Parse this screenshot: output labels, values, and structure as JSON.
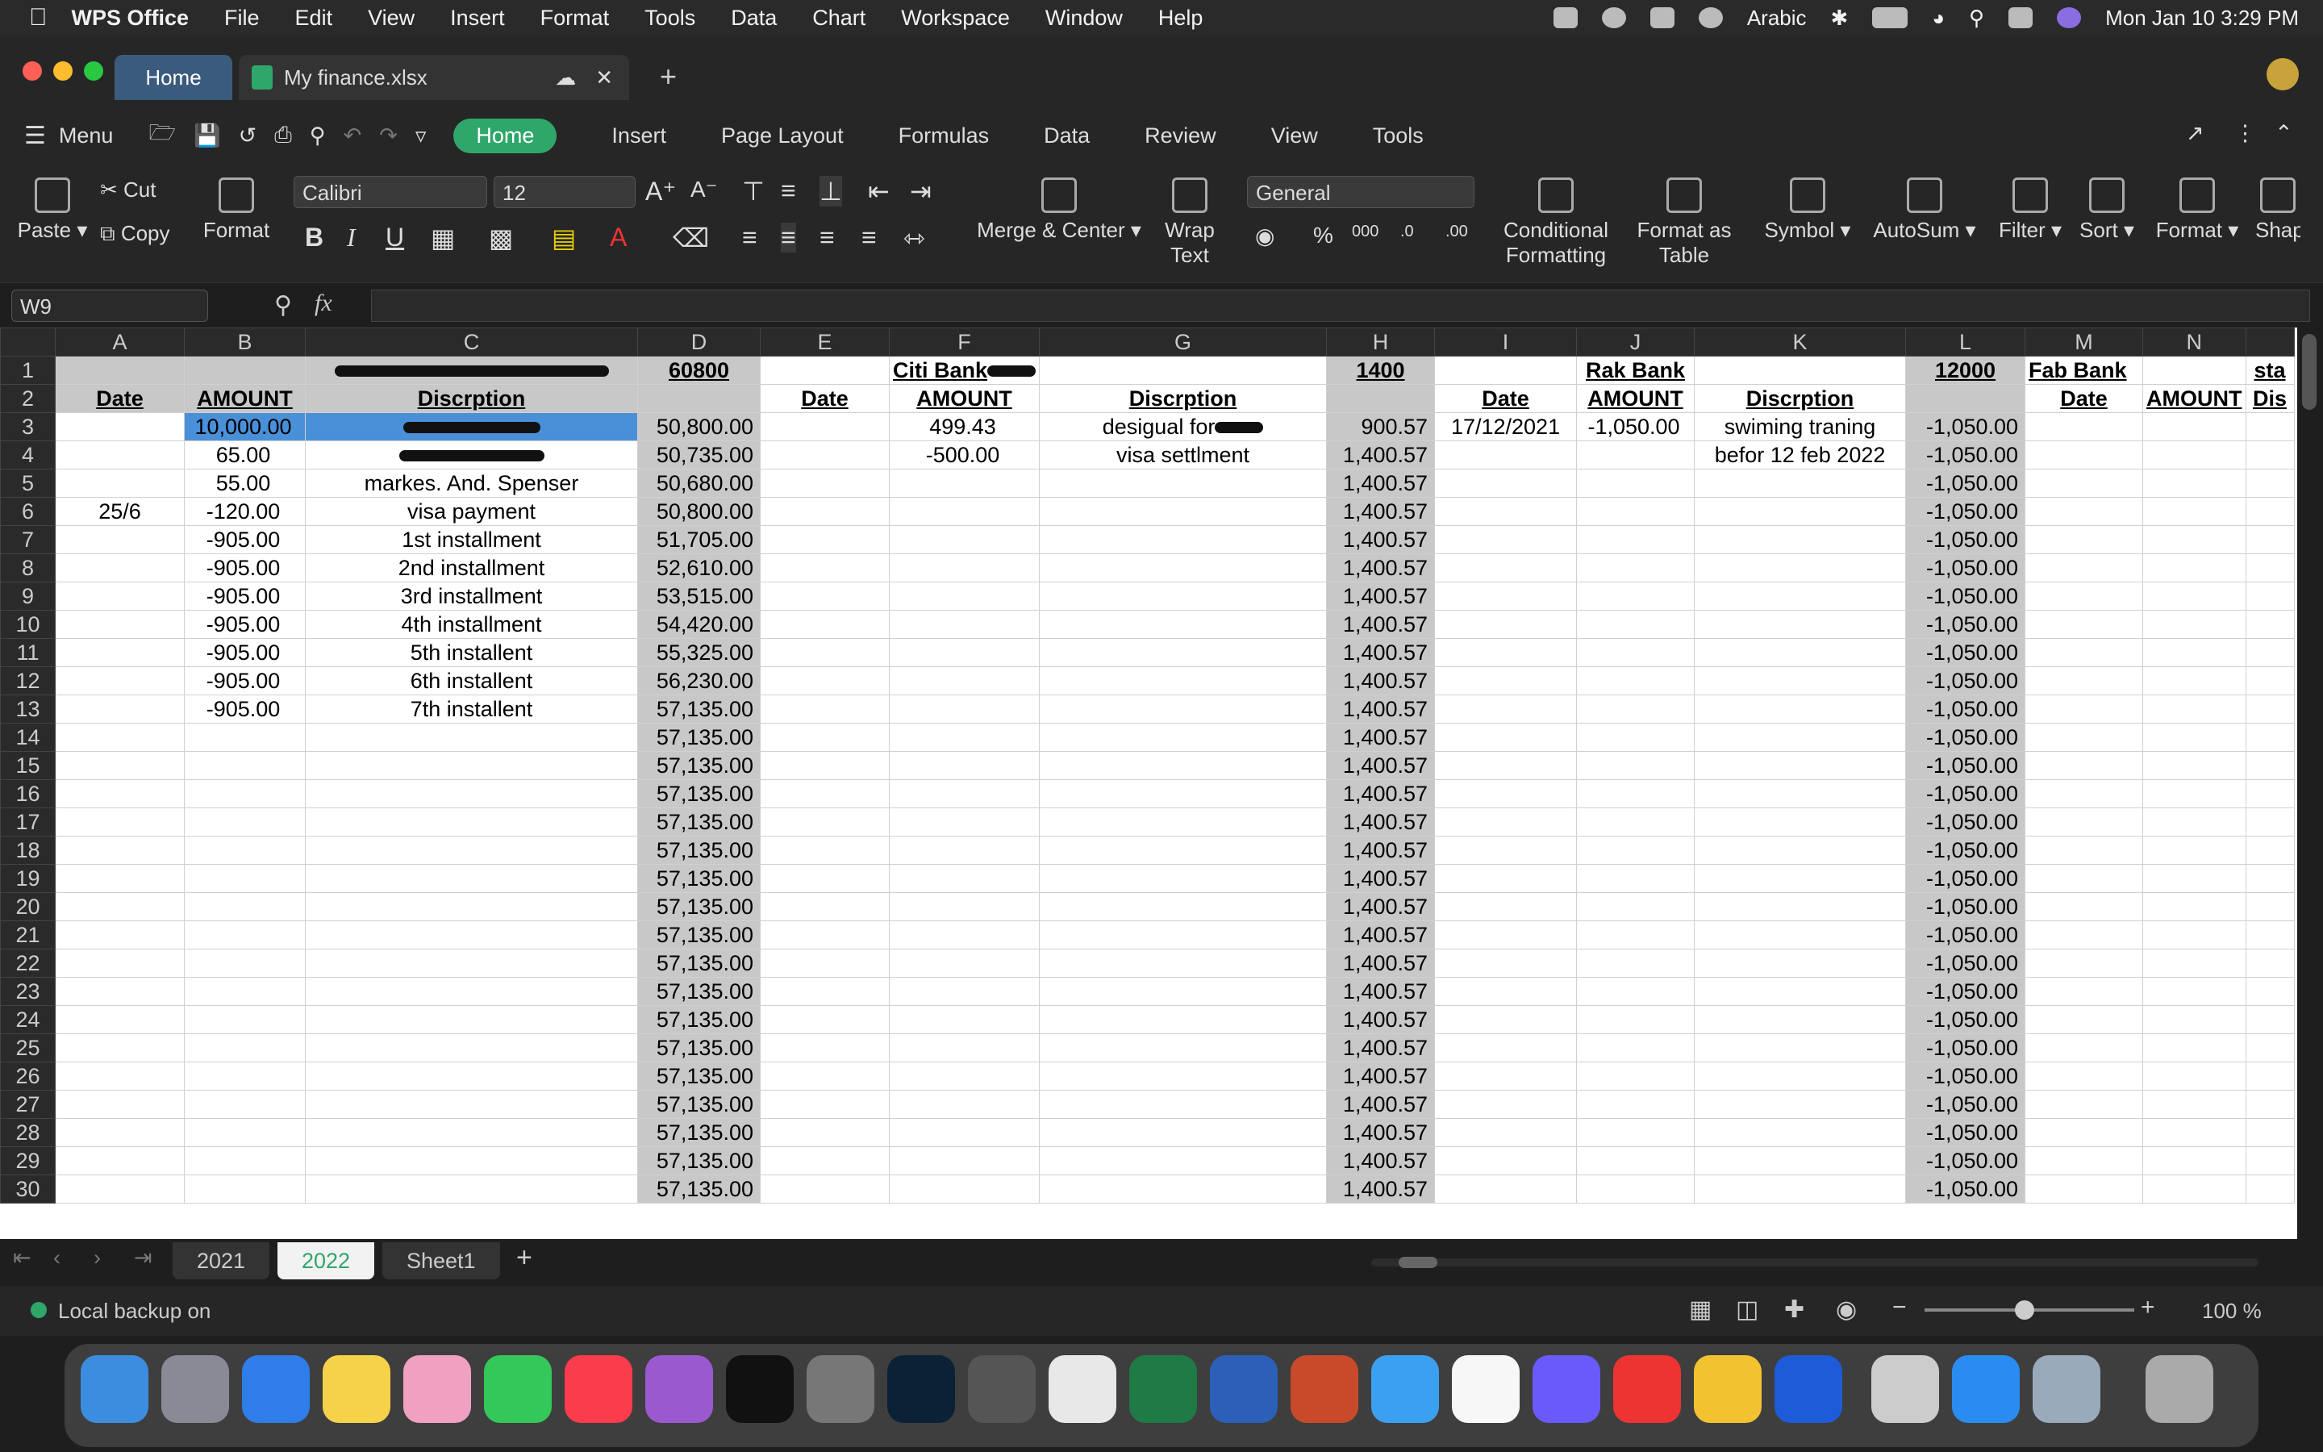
{
  "menubar": {
    "app": "WPS Office",
    "items": [
      "File",
      "Edit",
      "View",
      "Insert",
      "Format",
      "Tools",
      "Data",
      "Chart",
      "Workspace",
      "Window",
      "Help"
    ],
    "input_source": "Arabic",
    "clock": "Mon Jan 10  3:29 PM"
  },
  "window": {
    "home_tab": "Home",
    "file_tab": "My finance.xlsx"
  },
  "ribbon_tabs": [
    "Menu",
    "Home",
    "Insert",
    "Page Layout",
    "Formulas",
    "Data",
    "Review",
    "View",
    "Tools"
  ],
  "ribbon": {
    "paste": "Paste",
    "cut": "Cut",
    "copy": "Copy",
    "format_painter": "Format",
    "font": "Calibri",
    "size": "12",
    "merge": "Merge & Center",
    "wrap1": "Wrap",
    "wrap2": "Text",
    "numfmt": "General",
    "cond1": "Conditional",
    "cond2": "Formatting",
    "fmt_table1": "Format as",
    "fmt_table2": "Table",
    "symbol": "Symbol",
    "autosum": "AutoSum",
    "filter": "Filter",
    "sort": "Sort",
    "format": "Format",
    "shape": "Shap"
  },
  "formula_bar": {
    "name_box": "W9",
    "fx": "fx",
    "value": ""
  },
  "columns": [
    "A",
    "B",
    "C",
    "D",
    "E",
    "F",
    "G",
    "H",
    "I",
    "J",
    "K",
    "L",
    "M",
    "N",
    ""
  ],
  "rows": [
    [
      "",
      "",
      "",
      "60800",
      "",
      "Citi Bank",
      "",
      "1400",
      "",
      "Rak Bank",
      "",
      "12000",
      "Fab Bank",
      "",
      "sta"
    ],
    [
      "Date",
      "AMOUNT",
      "Discrption",
      "",
      "Date",
      "AMOUNT",
      "Discrption",
      "",
      "Date",
      "AMOUNT",
      "Discrption",
      "",
      "Date",
      "AMOUNT",
      "Dis"
    ],
    [
      "",
      "10,000.00",
      "",
      "50,800.00",
      "",
      "499.43",
      "desigual for",
      "900.57",
      "17/12/2021",
      "-1,050.00",
      "swiming traning",
      "-1,050.00",
      "",
      "",
      ""
    ],
    [
      "",
      "65.00",
      "",
      "50,735.00",
      "",
      "-500.00",
      "visa settlment",
      "1,400.57",
      "",
      "",
      "befor 12 feb 2022",
      "-1,050.00",
      "",
      "",
      ""
    ],
    [
      "",
      "55.00",
      "markes. And. Spenser",
      "50,680.00",
      "",
      "",
      "",
      "1,400.57",
      "",
      "",
      "",
      "-1,050.00",
      "",
      "",
      ""
    ],
    [
      "25/6",
      "-120.00",
      "visa  payment",
      "50,800.00",
      "",
      "",
      "",
      "1,400.57",
      "",
      "",
      "",
      "-1,050.00",
      "",
      "",
      ""
    ],
    [
      "",
      "-905.00",
      "1st installment",
      "51,705.00",
      "",
      "",
      "",
      "1,400.57",
      "",
      "",
      "",
      "-1,050.00",
      "",
      "",
      ""
    ],
    [
      "",
      "-905.00",
      "2nd installment",
      "52,610.00",
      "",
      "",
      "",
      "1,400.57",
      "",
      "",
      "",
      "-1,050.00",
      "",
      "",
      ""
    ],
    [
      "",
      "-905.00",
      "3rd installment",
      "53,515.00",
      "",
      "",
      "",
      "1,400.57",
      "",
      "",
      "",
      "-1,050.00",
      "",
      "",
      ""
    ],
    [
      "",
      "-905.00",
      "4th installment",
      "54,420.00",
      "",
      "",
      "",
      "1,400.57",
      "",
      "",
      "",
      "-1,050.00",
      "",
      "",
      ""
    ],
    [
      "",
      "-905.00",
      "5th installent",
      "55,325.00",
      "",
      "",
      "",
      "1,400.57",
      "",
      "",
      "",
      "-1,050.00",
      "",
      "",
      ""
    ],
    [
      "",
      "-905.00",
      "6th installent",
      "56,230.00",
      "",
      "",
      "",
      "1,400.57",
      "",
      "",
      "",
      "-1,050.00",
      "",
      "",
      ""
    ],
    [
      "",
      "-905.00",
      "7th installent",
      "57,135.00",
      "",
      "",
      "",
      "1,400.57",
      "",
      "",
      "",
      "-1,050.00",
      "",
      "",
      ""
    ],
    [
      "",
      "",
      "",
      "57,135.00",
      "",
      "",
      "",
      "1,400.57",
      "",
      "",
      "",
      "-1,050.00",
      "",
      "",
      ""
    ],
    [
      "",
      "",
      "",
      "57,135.00",
      "",
      "",
      "",
      "1,400.57",
      "",
      "",
      "",
      "-1,050.00",
      "",
      "",
      ""
    ],
    [
      "",
      "",
      "",
      "57,135.00",
      "",
      "",
      "",
      "1,400.57",
      "",
      "",
      "",
      "-1,050.00",
      "",
      "",
      ""
    ],
    [
      "",
      "",
      "",
      "57,135.00",
      "",
      "",
      "",
      "1,400.57",
      "",
      "",
      "",
      "-1,050.00",
      "",
      "",
      ""
    ],
    [
      "",
      "",
      "",
      "57,135.00",
      "",
      "",
      "",
      "1,400.57",
      "",
      "",
      "",
      "-1,050.00",
      "",
      "",
      ""
    ],
    [
      "",
      "",
      "",
      "57,135.00",
      "",
      "",
      "",
      "1,400.57",
      "",
      "",
      "",
      "-1,050.00",
      "",
      "",
      ""
    ],
    [
      "",
      "",
      "",
      "57,135.00",
      "",
      "",
      "",
      "1,400.57",
      "",
      "",
      "",
      "-1,050.00",
      "",
      "",
      ""
    ],
    [
      "",
      "",
      "",
      "57,135.00",
      "",
      "",
      "",
      "1,400.57",
      "",
      "",
      "",
      "-1,050.00",
      "",
      "",
      ""
    ],
    [
      "",
      "",
      "",
      "57,135.00",
      "",
      "",
      "",
      "1,400.57",
      "",
      "",
      "",
      "-1,050.00",
      "",
      "",
      ""
    ],
    [
      "",
      "",
      "",
      "57,135.00",
      "",
      "",
      "",
      "1,400.57",
      "",
      "",
      "",
      "-1,050.00",
      "",
      "",
      ""
    ],
    [
      "",
      "",
      "",
      "57,135.00",
      "",
      "",
      "",
      "1,400.57",
      "",
      "",
      "",
      "-1,050.00",
      "",
      "",
      ""
    ],
    [
      "",
      "",
      "",
      "57,135.00",
      "",
      "",
      "",
      "1,400.57",
      "",
      "",
      "",
      "-1,050.00",
      "",
      "",
      ""
    ],
    [
      "",
      "",
      "",
      "57,135.00",
      "",
      "",
      "",
      "1,400.57",
      "",
      "",
      "",
      "-1,050.00",
      "",
      "",
      ""
    ],
    [
      "",
      "",
      "",
      "57,135.00",
      "",
      "",
      "",
      "1,400.57",
      "",
      "",
      "",
      "-1,050.00",
      "",
      "",
      ""
    ],
    [
      "",
      "",
      "",
      "57,135.00",
      "",
      "",
      "",
      "1,400.57",
      "",
      "",
      "",
      "-1,050.00",
      "",
      "",
      ""
    ],
    [
      "",
      "",
      "",
      "57,135.00",
      "",
      "",
      "",
      "1,400.57",
      "",
      "",
      "",
      "-1,050.00",
      "",
      "",
      ""
    ],
    [
      "",
      "",
      "",
      "57,135.00",
      "",
      "",
      "",
      "1,400.57",
      "",
      "",
      "",
      "-1,050.00",
      "",
      "",
      ""
    ]
  ],
  "sheet_tabs": [
    "2021",
    "2022",
    "Sheet1"
  ],
  "active_sheet": "2022",
  "status": {
    "backup": "Local backup on",
    "zoom": "100 %"
  },
  "colors": {
    "accent": "#2fa66a",
    "selection": "#4a90d9",
    "header_gray": "#c8c8c8"
  }
}
